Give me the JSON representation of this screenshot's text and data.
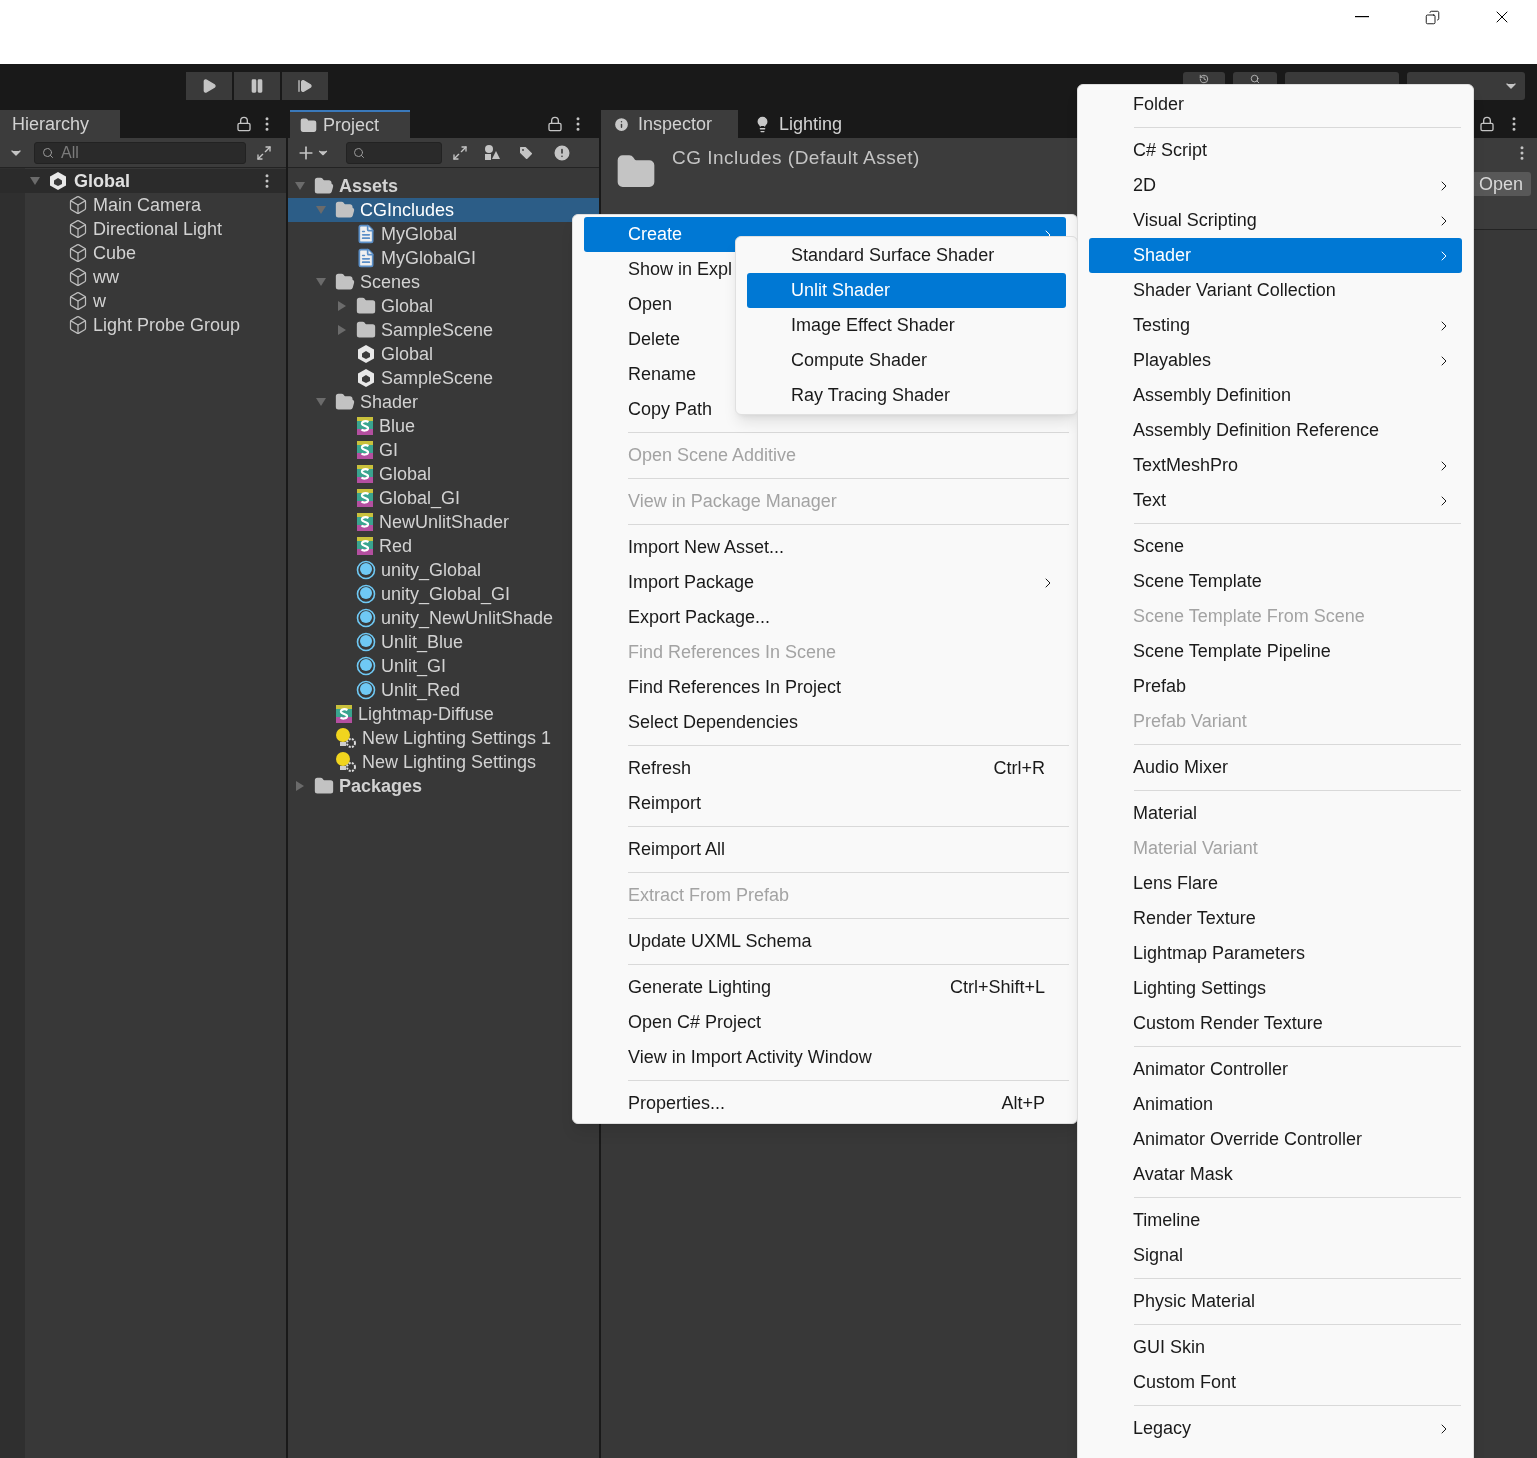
{
  "hierarchy": {
    "tab": "Hierarchy",
    "search": {
      "placeholder": "All"
    },
    "tree": [
      {
        "label": "Global",
        "kind": "scene",
        "expanded": true,
        "selected": false,
        "children": [
          {
            "label": "Main Camera",
            "kind": "cube",
            "selected": false
          },
          {
            "label": "Directional Light",
            "kind": "cube",
            "selected": false
          },
          {
            "label": "Cube",
            "kind": "cube",
            "selected": false
          },
          {
            "label": "ww",
            "kind": "cube",
            "selected": false
          },
          {
            "label": "w",
            "kind": "cube",
            "selected": false
          },
          {
            "label": "Light Probe Group",
            "kind": "cube",
            "selected": false
          }
        ]
      }
    ]
  },
  "project": {
    "tab": "Project",
    "tree": [
      {
        "label": "Assets",
        "kind": "folder",
        "expanded": true,
        "selected": false,
        "children": [
          {
            "label": "CGIncludes",
            "kind": "folder",
            "expanded": true,
            "selected": true,
            "children": [
              {
                "label": "MyGlobal",
                "kind": "text",
                "selected": false
              },
              {
                "label": "MyGlobalGI",
                "kind": "text",
                "selected": false
              }
            ]
          },
          {
            "label": "Scenes",
            "kind": "folder",
            "expanded": true,
            "selected": false,
            "children": [
              {
                "label": "Global",
                "kind": "folder",
                "expanded": false,
                "selected": false
              },
              {
                "label": "SampleScene",
                "kind": "folder",
                "expanded": false,
                "selected": false
              },
              {
                "label": "Global",
                "kind": "scene",
                "selected": false
              },
              {
                "label": "SampleScene",
                "kind": "scene",
                "selected": false
              }
            ]
          },
          {
            "label": "Shader",
            "kind": "folder",
            "expanded": true,
            "selected": false,
            "children": [
              {
                "label": "Blue",
                "kind": "shader",
                "selected": false
              },
              {
                "label": "GI",
                "kind": "shader",
                "selected": false
              },
              {
                "label": "Global",
                "kind": "shader",
                "selected": false
              },
              {
                "label": "Global_GI",
                "kind": "shader",
                "selected": false
              },
              {
                "label": "NewUnlitShader",
                "kind": "shader",
                "selected": false
              },
              {
                "label": "Red",
                "kind": "shader",
                "selected": false
              },
              {
                "label": "unity_Global",
                "kind": "variant",
                "selected": false
              },
              {
                "label": "unity_Global_GI",
                "kind": "variant",
                "selected": false
              },
              {
                "label": "unity_NewUnlitShade",
                "kind": "variant",
                "selected": false
              },
              {
                "label": "Unlit_Blue",
                "kind": "variant",
                "selected": false
              },
              {
                "label": "Unlit_GI",
                "kind": "variant",
                "selected": false
              },
              {
                "label": "Unlit_Red",
                "kind": "variant",
                "selected": false
              }
            ]
          },
          {
            "label": "Lightmap-Diffuse",
            "kind": "shader",
            "selected": false
          },
          {
            "label": "New Lighting Settings 1",
            "kind": "lighting",
            "selected": false
          },
          {
            "label": "New Lighting Settings",
            "kind": "lighting",
            "selected": false
          }
        ]
      },
      {
        "label": "Packages",
        "kind": "folder",
        "expanded": false,
        "selected": false
      }
    ]
  },
  "inspector": {
    "tabs": [
      {
        "label": "Inspector",
        "selected": true
      },
      {
        "label": "Lighting",
        "selected": false
      }
    ],
    "title": "CG Includes (Default Asset)",
    "open_button": "Open"
  },
  "context_menu": {
    "items": [
      {
        "kind": "item",
        "label": "Create",
        "selected": true,
        "disabled": false,
        "submenu": true
      },
      {
        "kind": "item",
        "label": "Show in Expl",
        "selected": false,
        "disabled": false,
        "submenu": false
      },
      {
        "kind": "item",
        "label": "Open",
        "selected": false,
        "disabled": false,
        "submenu": false
      },
      {
        "kind": "item",
        "label": "Delete",
        "selected": false,
        "disabled": false,
        "submenu": false
      },
      {
        "kind": "item",
        "label": "Rename",
        "selected": false,
        "disabled": false,
        "submenu": false
      },
      {
        "kind": "item",
        "label": "Copy Path",
        "selected": false,
        "disabled": false,
        "submenu": false
      },
      {
        "kind": "separator"
      },
      {
        "kind": "item",
        "label": "Open Scene Additive",
        "selected": false,
        "disabled": true,
        "submenu": false
      },
      {
        "kind": "separator"
      },
      {
        "kind": "item",
        "label": "View in Package Manager",
        "selected": false,
        "disabled": true,
        "submenu": false
      },
      {
        "kind": "separator"
      },
      {
        "kind": "item",
        "label": "Import New Asset...",
        "selected": false,
        "disabled": false,
        "submenu": false
      },
      {
        "kind": "item",
        "label": "Import Package",
        "selected": false,
        "disabled": false,
        "submenu": true
      },
      {
        "kind": "item",
        "label": "Export Package...",
        "selected": false,
        "disabled": false,
        "submenu": false
      },
      {
        "kind": "item",
        "label": "Find References In Scene",
        "selected": false,
        "disabled": true,
        "submenu": false
      },
      {
        "kind": "item",
        "label": "Find References In Project",
        "selected": false,
        "disabled": false,
        "submenu": false
      },
      {
        "kind": "item",
        "label": "Select Dependencies",
        "selected": false,
        "disabled": false,
        "submenu": false
      },
      {
        "kind": "separator"
      },
      {
        "kind": "item",
        "label": "Refresh",
        "shortcut": "Ctrl+R",
        "selected": false,
        "disabled": false,
        "submenu": false
      },
      {
        "kind": "item",
        "label": "Reimport",
        "selected": false,
        "disabled": false,
        "submenu": false
      },
      {
        "kind": "separator"
      },
      {
        "kind": "item",
        "label": "Reimport All",
        "selected": false,
        "disabled": false,
        "submenu": false
      },
      {
        "kind": "separator"
      },
      {
        "kind": "item",
        "label": "Extract From Prefab",
        "selected": false,
        "disabled": true,
        "submenu": false
      },
      {
        "kind": "separator"
      },
      {
        "kind": "item",
        "label": "Update UXML Schema",
        "selected": false,
        "disabled": false,
        "submenu": false
      },
      {
        "kind": "separator"
      },
      {
        "kind": "item",
        "label": "Generate Lighting",
        "shortcut": "Ctrl+Shift+L",
        "selected": false,
        "disabled": false,
        "submenu": false
      },
      {
        "kind": "item",
        "label": "Open C# Project",
        "selected": false,
        "disabled": false,
        "submenu": false
      },
      {
        "kind": "item",
        "label": "View in Import Activity Window",
        "selected": false,
        "disabled": false,
        "submenu": false
      },
      {
        "kind": "separator"
      },
      {
        "kind": "item",
        "label": "Properties...",
        "shortcut": "Alt+P",
        "selected": false,
        "disabled": false,
        "submenu": false
      }
    ]
  },
  "shader_submenu": {
    "items": [
      {
        "kind": "item",
        "label": "Standard Surface Shader",
        "selected": false,
        "disabled": false,
        "submenu": false
      },
      {
        "kind": "item",
        "label": "Unlit Shader",
        "selected": true,
        "disabled": false,
        "submenu": false
      },
      {
        "kind": "item",
        "label": "Image Effect Shader",
        "selected": false,
        "disabled": false,
        "submenu": false
      },
      {
        "kind": "item",
        "label": "Compute Shader",
        "selected": false,
        "disabled": false,
        "submenu": false
      },
      {
        "kind": "item",
        "label": "Ray Tracing Shader",
        "selected": false,
        "disabled": false,
        "submenu": false
      }
    ]
  },
  "create_menu": {
    "items": [
      {
        "kind": "item",
        "label": "Folder",
        "selected": false,
        "disabled": false,
        "submenu": false
      },
      {
        "kind": "separator"
      },
      {
        "kind": "item",
        "label": "C# Script",
        "selected": false,
        "disabled": false,
        "submenu": false
      },
      {
        "kind": "item",
        "label": "2D",
        "selected": false,
        "disabled": false,
        "submenu": true
      },
      {
        "kind": "item",
        "label": "Visual Scripting",
        "selected": false,
        "disabled": false,
        "submenu": true
      },
      {
        "kind": "item",
        "label": "Shader",
        "selected": true,
        "disabled": false,
        "submenu": true
      },
      {
        "kind": "item",
        "label": "Shader Variant Collection",
        "selected": false,
        "disabled": false,
        "submenu": false
      },
      {
        "kind": "item",
        "label": "Testing",
        "selected": false,
        "disabled": false,
        "submenu": true
      },
      {
        "kind": "item",
        "label": "Playables",
        "selected": false,
        "disabled": false,
        "submenu": true
      },
      {
        "kind": "item",
        "label": "Assembly Definition",
        "selected": false,
        "disabled": false,
        "submenu": false
      },
      {
        "kind": "item",
        "label": "Assembly Definition Reference",
        "selected": false,
        "disabled": false,
        "submenu": false
      },
      {
        "kind": "item",
        "label": "TextMeshPro",
        "selected": false,
        "disabled": false,
        "submenu": true
      },
      {
        "kind": "item",
        "label": "Text",
        "selected": false,
        "disabled": false,
        "submenu": true
      },
      {
        "kind": "separator"
      },
      {
        "kind": "item",
        "label": "Scene",
        "selected": false,
        "disabled": false,
        "submenu": false
      },
      {
        "kind": "item",
        "label": "Scene Template",
        "selected": false,
        "disabled": false,
        "submenu": false
      },
      {
        "kind": "item",
        "label": "Scene Template From Scene",
        "selected": false,
        "disabled": true,
        "submenu": false
      },
      {
        "kind": "item",
        "label": "Scene Template Pipeline",
        "selected": false,
        "disabled": false,
        "submenu": false
      },
      {
        "kind": "item",
        "label": "Prefab",
        "selected": false,
        "disabled": false,
        "submenu": false
      },
      {
        "kind": "item",
        "label": "Prefab Variant",
        "selected": false,
        "disabled": true,
        "submenu": false
      },
      {
        "kind": "separator"
      },
      {
        "kind": "item",
        "label": "Audio Mixer",
        "selected": false,
        "disabled": false,
        "submenu": false
      },
      {
        "kind": "separator"
      },
      {
        "kind": "item",
        "label": "Material",
        "selected": false,
        "disabled": false,
        "submenu": false
      },
      {
        "kind": "item",
        "label": "Material Variant",
        "selected": false,
        "disabled": true,
        "submenu": false
      },
      {
        "kind": "item",
        "label": "Lens Flare",
        "selected": false,
        "disabled": false,
        "submenu": false
      },
      {
        "kind": "item",
        "label": "Render Texture",
        "selected": false,
        "disabled": false,
        "submenu": false
      },
      {
        "kind": "item",
        "label": "Lightmap Parameters",
        "selected": false,
        "disabled": false,
        "submenu": false
      },
      {
        "kind": "item",
        "label": "Lighting Settings",
        "selected": false,
        "disabled": false,
        "submenu": false
      },
      {
        "kind": "item",
        "label": "Custom Render Texture",
        "selected": false,
        "disabled": false,
        "submenu": false
      },
      {
        "kind": "separator"
      },
      {
        "kind": "item",
        "label": "Animator Controller",
        "selected": false,
        "disabled": false,
        "submenu": false
      },
      {
        "kind": "item",
        "label": "Animation",
        "selected": false,
        "disabled": false,
        "submenu": false
      },
      {
        "kind": "item",
        "label": "Animator Override Controller",
        "selected": false,
        "disabled": false,
        "submenu": false
      },
      {
        "kind": "item",
        "label": "Avatar Mask",
        "selected": false,
        "disabled": false,
        "submenu": false
      },
      {
        "kind": "separator"
      },
      {
        "kind": "item",
        "label": "Timeline",
        "selected": false,
        "disabled": false,
        "submenu": false
      },
      {
        "kind": "item",
        "label": "Signal",
        "selected": false,
        "disabled": false,
        "submenu": false
      },
      {
        "kind": "separator"
      },
      {
        "kind": "item",
        "label": "Physic Material",
        "selected": false,
        "disabled": false,
        "submenu": false
      },
      {
        "kind": "separator"
      },
      {
        "kind": "item",
        "label": "GUI Skin",
        "selected": false,
        "disabled": false,
        "submenu": false
      },
      {
        "kind": "item",
        "label": "Custom Font",
        "selected": false,
        "disabled": false,
        "submenu": false
      },
      {
        "kind": "separator"
      },
      {
        "kind": "item",
        "label": "Legacy",
        "selected": false,
        "disabled": false,
        "submenu": true
      }
    ]
  }
}
